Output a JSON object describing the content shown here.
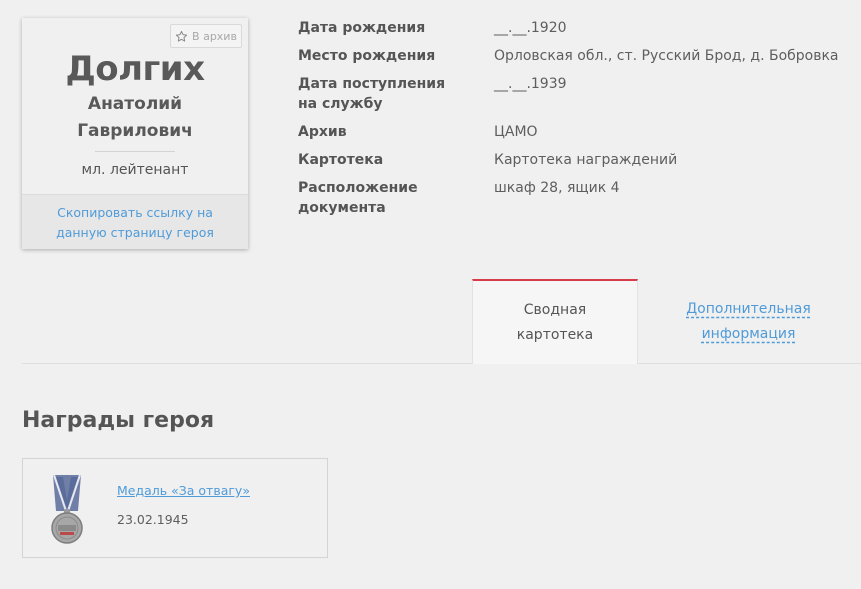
{
  "hero": {
    "surname": "Долгих",
    "first_name": "Анатолий",
    "patronymic": "Гаврилович",
    "rank": "мл. лейтенант",
    "archive_button": "В архив",
    "copy_link": "Скопировать ссылку на данную страницу героя"
  },
  "info_rows": [
    {
      "label": "Дата рождения",
      "value": "__.__.1920"
    },
    {
      "label": "Место рождения",
      "value": "Орловская обл., ст. Русский Брод, д. Бобровка"
    },
    {
      "label": "Дата поступления на службу",
      "value": "__.__.1939"
    },
    {
      "label": "Архив",
      "value": "ЦАМО"
    },
    {
      "label": "Картотека",
      "value": "Картотека награждений"
    },
    {
      "label": "Расположение документа",
      "value": "шкаф 28, ящик 4"
    }
  ],
  "tabs": [
    {
      "label": "Сводная картотека",
      "active": true
    },
    {
      "label": "Дополнительная информация",
      "active": false
    }
  ],
  "awards_title": "Награды героя",
  "awards": [
    {
      "name": "Медаль «За отвагу»",
      "date": "23.02.1945"
    }
  ],
  "colors": {
    "link": "#4f9bd9",
    "active_tab_accent": "#d83b4a",
    "background": "#f0f0f0"
  },
  "icons": {
    "archive": "star-outline-icon",
    "award": "medal-icon"
  }
}
